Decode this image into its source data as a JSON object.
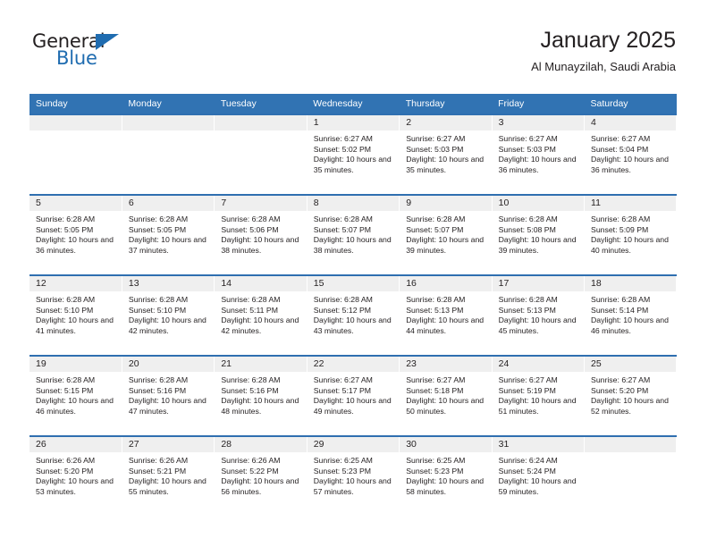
{
  "brand": {
    "name_top": "General",
    "name_bottom": "Blue",
    "accent_color": "#1f6cb0"
  },
  "header": {
    "title": "January 2025",
    "subtitle": "Al Munayzilah, Saudi Arabia",
    "header_bg_color": "#3173b3",
    "row_divider_color": "#2f6fb0",
    "daynum_bg_color": "#efefef"
  },
  "weekday_headers": [
    "Sunday",
    "Monday",
    "Tuesday",
    "Wednesday",
    "Thursday",
    "Friday",
    "Saturday"
  ],
  "weeks": [
    [
      {
        "day": "",
        "info": "",
        "empty": true
      },
      {
        "day": "",
        "info": "",
        "empty": true
      },
      {
        "day": "",
        "info": "",
        "empty": true
      },
      {
        "day": "1",
        "info": "Sunrise: 6:27 AM\nSunset: 5:02 PM\nDaylight: 10 hours and 35 minutes.",
        "empty": false
      },
      {
        "day": "2",
        "info": "Sunrise: 6:27 AM\nSunset: 5:03 PM\nDaylight: 10 hours and 35 minutes.",
        "empty": false
      },
      {
        "day": "3",
        "info": "Sunrise: 6:27 AM\nSunset: 5:03 PM\nDaylight: 10 hours and 36 minutes.",
        "empty": false
      },
      {
        "day": "4",
        "info": "Sunrise: 6:27 AM\nSunset: 5:04 PM\nDaylight: 10 hours and 36 minutes.",
        "empty": false
      }
    ],
    [
      {
        "day": "5",
        "info": "Sunrise: 6:28 AM\nSunset: 5:05 PM\nDaylight: 10 hours and 36 minutes.",
        "empty": false
      },
      {
        "day": "6",
        "info": "Sunrise: 6:28 AM\nSunset: 5:05 PM\nDaylight: 10 hours and 37 minutes.",
        "empty": false
      },
      {
        "day": "7",
        "info": "Sunrise: 6:28 AM\nSunset: 5:06 PM\nDaylight: 10 hours and 38 minutes.",
        "empty": false
      },
      {
        "day": "8",
        "info": "Sunrise: 6:28 AM\nSunset: 5:07 PM\nDaylight: 10 hours and 38 minutes.",
        "empty": false
      },
      {
        "day": "9",
        "info": "Sunrise: 6:28 AM\nSunset: 5:07 PM\nDaylight: 10 hours and 39 minutes.",
        "empty": false
      },
      {
        "day": "10",
        "info": "Sunrise: 6:28 AM\nSunset: 5:08 PM\nDaylight: 10 hours and 39 minutes.",
        "empty": false
      },
      {
        "day": "11",
        "info": "Sunrise: 6:28 AM\nSunset: 5:09 PM\nDaylight: 10 hours and 40 minutes.",
        "empty": false
      }
    ],
    [
      {
        "day": "12",
        "info": "Sunrise: 6:28 AM\nSunset: 5:10 PM\nDaylight: 10 hours and 41 minutes.",
        "empty": false
      },
      {
        "day": "13",
        "info": "Sunrise: 6:28 AM\nSunset: 5:10 PM\nDaylight: 10 hours and 42 minutes.",
        "empty": false
      },
      {
        "day": "14",
        "info": "Sunrise: 6:28 AM\nSunset: 5:11 PM\nDaylight: 10 hours and 42 minutes.",
        "empty": false
      },
      {
        "day": "15",
        "info": "Sunrise: 6:28 AM\nSunset: 5:12 PM\nDaylight: 10 hours and 43 minutes.",
        "empty": false
      },
      {
        "day": "16",
        "info": "Sunrise: 6:28 AM\nSunset: 5:13 PM\nDaylight: 10 hours and 44 minutes.",
        "empty": false
      },
      {
        "day": "17",
        "info": "Sunrise: 6:28 AM\nSunset: 5:13 PM\nDaylight: 10 hours and 45 minutes.",
        "empty": false
      },
      {
        "day": "18",
        "info": "Sunrise: 6:28 AM\nSunset: 5:14 PM\nDaylight: 10 hours and 46 minutes.",
        "empty": false
      }
    ],
    [
      {
        "day": "19",
        "info": "Sunrise: 6:28 AM\nSunset: 5:15 PM\nDaylight: 10 hours and 46 minutes.",
        "empty": false
      },
      {
        "day": "20",
        "info": "Sunrise: 6:28 AM\nSunset: 5:16 PM\nDaylight: 10 hours and 47 minutes.",
        "empty": false
      },
      {
        "day": "21",
        "info": "Sunrise: 6:28 AM\nSunset: 5:16 PM\nDaylight: 10 hours and 48 minutes.",
        "empty": false
      },
      {
        "day": "22",
        "info": "Sunrise: 6:27 AM\nSunset: 5:17 PM\nDaylight: 10 hours and 49 minutes.",
        "empty": false
      },
      {
        "day": "23",
        "info": "Sunrise: 6:27 AM\nSunset: 5:18 PM\nDaylight: 10 hours and 50 minutes.",
        "empty": false
      },
      {
        "day": "24",
        "info": "Sunrise: 6:27 AM\nSunset: 5:19 PM\nDaylight: 10 hours and 51 minutes.",
        "empty": false
      },
      {
        "day": "25",
        "info": "Sunrise: 6:27 AM\nSunset: 5:20 PM\nDaylight: 10 hours and 52 minutes.",
        "empty": false
      }
    ],
    [
      {
        "day": "26",
        "info": "Sunrise: 6:26 AM\nSunset: 5:20 PM\nDaylight: 10 hours and 53 minutes.",
        "empty": false
      },
      {
        "day": "27",
        "info": "Sunrise: 6:26 AM\nSunset: 5:21 PM\nDaylight: 10 hours and 55 minutes.",
        "empty": false
      },
      {
        "day": "28",
        "info": "Sunrise: 6:26 AM\nSunset: 5:22 PM\nDaylight: 10 hours and 56 minutes.",
        "empty": false
      },
      {
        "day": "29",
        "info": "Sunrise: 6:25 AM\nSunset: 5:23 PM\nDaylight: 10 hours and 57 minutes.",
        "empty": false
      },
      {
        "day": "30",
        "info": "Sunrise: 6:25 AM\nSunset: 5:23 PM\nDaylight: 10 hours and 58 minutes.",
        "empty": false
      },
      {
        "day": "31",
        "info": "Sunrise: 6:24 AM\nSunset: 5:24 PM\nDaylight: 10 hours and 59 minutes.",
        "empty": false
      },
      {
        "day": "",
        "info": "",
        "empty": true
      }
    ]
  ]
}
